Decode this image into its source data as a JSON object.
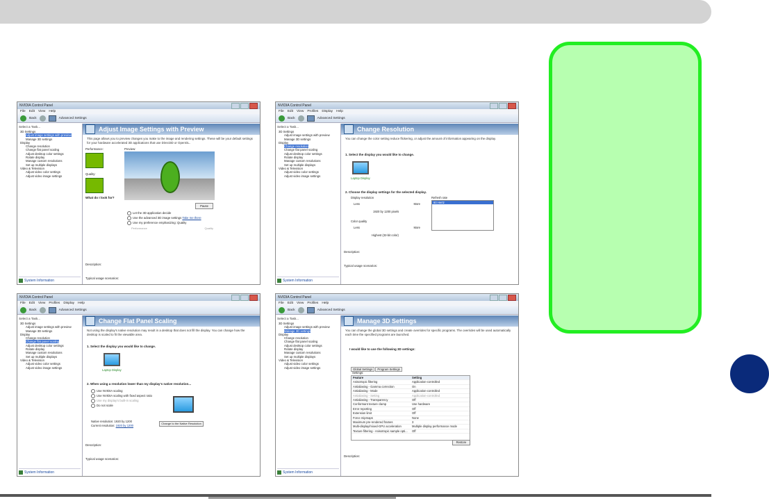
{
  "windows": [
    {
      "title": "NVIDIA Control Panel",
      "menu": [
        "File",
        "Edit",
        "View",
        "Help"
      ],
      "toolbar": {
        "back": "Back",
        "advanced": "Advanced Settings"
      },
      "task_label": "Select a Task...",
      "tree": [
        {
          "label": "3D Settings",
          "level": 0
        },
        {
          "label": "Adjust image settings with preview",
          "level": 1,
          "selected": true
        },
        {
          "label": "Manage 3D settings",
          "level": 1
        },
        {
          "label": "Display",
          "level": 0
        },
        {
          "label": "Change resolution",
          "level": 1
        },
        {
          "label": "Change flat panel scaling",
          "level": 1
        },
        {
          "label": "Adjust desktop color settings",
          "level": 1
        },
        {
          "label": "Rotate display",
          "level": 1
        },
        {
          "label": "Manage custom resolutions",
          "level": 1
        },
        {
          "label": "Set up multiple displays",
          "level": 1
        },
        {
          "label": "Video & Television",
          "level": 0
        },
        {
          "label": "Adjust video color settings",
          "level": 1
        },
        {
          "label": "Adjust video image settings",
          "level": 1
        }
      ],
      "system_info": "System Information",
      "header": "Adjust Image Settings with Preview",
      "description": "This page allows you to preview changes you make to the image and rendering settings. These will be your default settings for your hardware accelerated 3D applications that use Direct3D or OpenGL.",
      "performance_label": "Performance:",
      "preview_label": "Preview:",
      "quality_label": "Quality:",
      "pause_label": "Pause",
      "what_label": "What do I look for?",
      "opt1": "Let the 3D application decide",
      "opt2": "Use the advanced 3D image settings",
      "opt3": "Use my preference emphasizing: Quality",
      "take_me_there": "Take me there",
      "perf_slider_left": "Performance",
      "perf_slider_right": "Quality",
      "desc_label": "Description:",
      "typical": "Typical usage scenarios:"
    },
    {
      "title": "NVIDIA Control Panel",
      "menu": [
        "File",
        "Edit",
        "View",
        "Profiles",
        "Display",
        "Help"
      ],
      "toolbar": {
        "back": "Back",
        "advanced": "Advanced Settings"
      },
      "task_label": "Select a Task...",
      "tree": [
        {
          "label": "3D Settings",
          "level": 0
        },
        {
          "label": "Adjust image settings with preview",
          "level": 1
        },
        {
          "label": "Manage 3D settings",
          "level": 1
        },
        {
          "label": "Display",
          "level": 0
        },
        {
          "label": "Change resolution",
          "level": 1,
          "selected": true
        },
        {
          "label": "Change flat panel scaling",
          "level": 1
        },
        {
          "label": "Adjust desktop color settings",
          "level": 1
        },
        {
          "label": "Rotate display",
          "level": 1
        },
        {
          "label": "Manage custom resolutions",
          "level": 1
        },
        {
          "label": "Set up multiple displays",
          "level": 1
        },
        {
          "label": "Video & Television",
          "level": 0
        },
        {
          "label": "Adjust video color settings",
          "level": 1
        },
        {
          "label": "Adjust video image settings",
          "level": 1
        }
      ],
      "system_info": "System Information",
      "header": "Change Resolution",
      "description": "You can change the color setting reduce flickering, or adjust the amount of information appearing on the display.",
      "sec1": "1. Select the display you would like to change.",
      "display_name": "Laptop Display",
      "sec2": "2. Choose the display settings for the selected display.",
      "res_label": "Display resolution",
      "less": "Less",
      "more": "More",
      "res_value": "1920 by 1200 pixels",
      "refresh_label": "Refresh rate",
      "refresh_value": "60 Hertz",
      "color_label": "Color quality",
      "color_value": "Highest (32-bit color)",
      "desc_label": "Description:",
      "typical": "Typical usage scenarios:"
    },
    {
      "title": "NVIDIA Control Panel",
      "menu": [
        "File",
        "Edit",
        "View",
        "Profiles",
        "Display",
        "Help"
      ],
      "toolbar": {
        "back": "Back",
        "advanced": "Advanced Settings"
      },
      "task_label": "Select a Task...",
      "tree": [
        {
          "label": "3D Settings",
          "level": 0
        },
        {
          "label": "Adjust image settings with preview",
          "level": 1
        },
        {
          "label": "Manage 3D settings",
          "level": 1
        },
        {
          "label": "Display",
          "level": 0
        },
        {
          "label": "Change resolution",
          "level": 1
        },
        {
          "label": "Change flat panel scaling",
          "level": 1,
          "selected": true
        },
        {
          "label": "Adjust desktop color settings",
          "level": 1
        },
        {
          "label": "Rotate display",
          "level": 1
        },
        {
          "label": "Manage custom resolutions",
          "level": 1
        },
        {
          "label": "Set up multiple displays",
          "level": 1
        },
        {
          "label": "Video & Television",
          "level": 0
        },
        {
          "label": "Adjust video color settings",
          "level": 1
        },
        {
          "label": "Adjust video image settings",
          "level": 1
        }
      ],
      "system_info": "System Information",
      "header": "Change Flat Panel Scaling",
      "description": "Not using the display's native resolution may result in a desktop that does not fill the display. You can change how the desktop is scaled to fit the viewable area.",
      "sec1": "1. Select the display you would like to change.",
      "display_name": "Laptop Display",
      "sec2": "2. When using a resolution lower than my display's native resolution...",
      "opt1": "Use NVIDIA scaling",
      "opt2": "Use NVIDIA scaling with fixed aspect ratio",
      "opt3": "Use my display's built-in scaling",
      "opt4": "Do not scale",
      "native_label": "Native resolution:",
      "native_value": "1920 by 1200",
      "current_label": "Current resolution:",
      "current_value": "1920 by 1200",
      "change_btn": "Change to the Native Resolution",
      "desc_label": "Description:",
      "typical": "Typical usage scenarios:"
    },
    {
      "title": "NVIDIA Control Panel",
      "menu": [
        "File",
        "Edit",
        "View",
        "Profiles",
        "Help"
      ],
      "toolbar": {
        "back": "Back",
        "advanced": "Advanced Settings"
      },
      "task_label": "Select a Task...",
      "tree": [
        {
          "label": "3D Settings",
          "level": 0
        },
        {
          "label": "Adjust image settings with preview",
          "level": 1
        },
        {
          "label": "Manage 3D settings",
          "level": 1,
          "selected": true
        },
        {
          "label": "Display",
          "level": 0
        },
        {
          "label": "Change resolution",
          "level": 1
        },
        {
          "label": "Change flat panel scaling",
          "level": 1
        },
        {
          "label": "Adjust desktop color settings",
          "level": 1
        },
        {
          "label": "Rotate display",
          "level": 1
        },
        {
          "label": "Manage custom resolutions",
          "level": 1
        },
        {
          "label": "Set up multiple displays",
          "level": 1
        },
        {
          "label": "Video & Television",
          "level": 0
        },
        {
          "label": "Adjust video color settings",
          "level": 1
        },
        {
          "label": "Adjust video image settings",
          "level": 1
        }
      ],
      "system_info": "System Information",
      "header": "Manage 3D Settings",
      "description": "You can change the global 3D settings and create overrides for specific programs. The overrides will be used automatically each time the specified programs are launched.",
      "sec1": "I would like to use the following 3D settings:",
      "tab1": "Global Settings",
      "tab2": "Program Settings",
      "settings_label": "Settings:",
      "col_feature": "Feature",
      "col_setting": "Setting",
      "rows": [
        [
          "Anisotropic filtering",
          "Application-controlled"
        ],
        [
          "Antialiasing - Gamma correction",
          "On"
        ],
        [
          "Antialiasing - Mode",
          "Application-controlled"
        ],
        [
          "Antialiasing - Setting",
          "Application-controlled"
        ],
        [
          "Antialiasing - Transparency",
          "Off"
        ],
        [
          "Conformant texture clamp",
          "Use hardware"
        ],
        [
          "Error reporting",
          "Off"
        ],
        [
          "Extension limit",
          "Off"
        ],
        [
          "Force mipmaps",
          "None"
        ],
        [
          "Maximum pre-rendered frames",
          "3"
        ],
        [
          "Multi-display/mixed-GPU acceleration",
          "Multiple display performance mode"
        ],
        [
          "Texture filtering - Anisotropic sample opti...",
          "Off"
        ]
      ],
      "restore": "Restore",
      "desc_label": "Description:"
    }
  ]
}
